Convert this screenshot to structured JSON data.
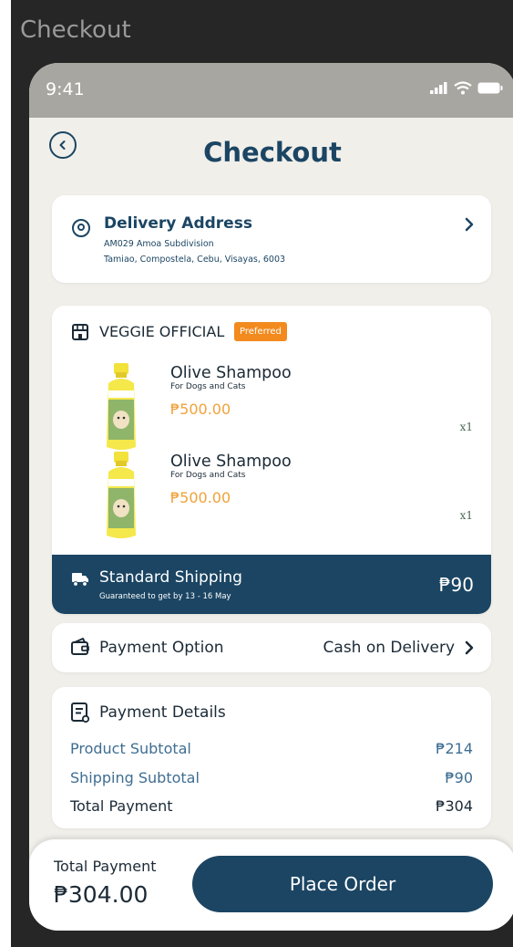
{
  "frame": {
    "title": "Checkout"
  },
  "status_bar": {
    "time": "9:41"
  },
  "header": {
    "title": "Checkout"
  },
  "address": {
    "title": "Delivery Address",
    "line1": "AM029 Amoa Subdivision",
    "line2": "Tamiao, Compostela, Cebu, Visayas, 6003"
  },
  "shop": {
    "name": "VEGGIE OFFICIAL",
    "badge": "Preferred",
    "items": [
      {
        "name": "Olive Shampoo",
        "subtitle": "For Dogs and Cats",
        "price": "₱500.00",
        "qty": "x1"
      },
      {
        "name": "Olive Shampoo",
        "subtitle": "For Dogs and Cats",
        "price": "₱500.00",
        "qty": "x1"
      }
    ],
    "shipping": {
      "title": "Standard Shipping",
      "subtitle": "Guaranteed to get by 13 - 16 May",
      "price": "₱90"
    }
  },
  "payment_option": {
    "label": "Payment Option",
    "value": "Cash on Delivery"
  },
  "payment_details": {
    "title": "Payment Details",
    "rows": [
      {
        "label": "Product Subtotal",
        "value": "₱214"
      },
      {
        "label": "Shipping Subtotal",
        "value": "₱90"
      },
      {
        "label": "Total Payment",
        "value": "₱304"
      }
    ]
  },
  "footer": {
    "total_label": "Total Payment",
    "total_amount": "₱304.00",
    "place_order_label": "Place Order"
  },
  "colors": {
    "primary": "#1b4563",
    "accent_orange": "#f28a1e",
    "price_orange": "#f0a23a",
    "background": "#f1efea",
    "statusbar": "#a8a6a1"
  },
  "icons": [
    "chevron-left-icon",
    "location-pin-icon",
    "chevron-right-icon",
    "store-icon",
    "truck-icon",
    "wallet-icon",
    "receipt-icon",
    "signal-icon",
    "wifi-icon",
    "battery-icon"
  ]
}
